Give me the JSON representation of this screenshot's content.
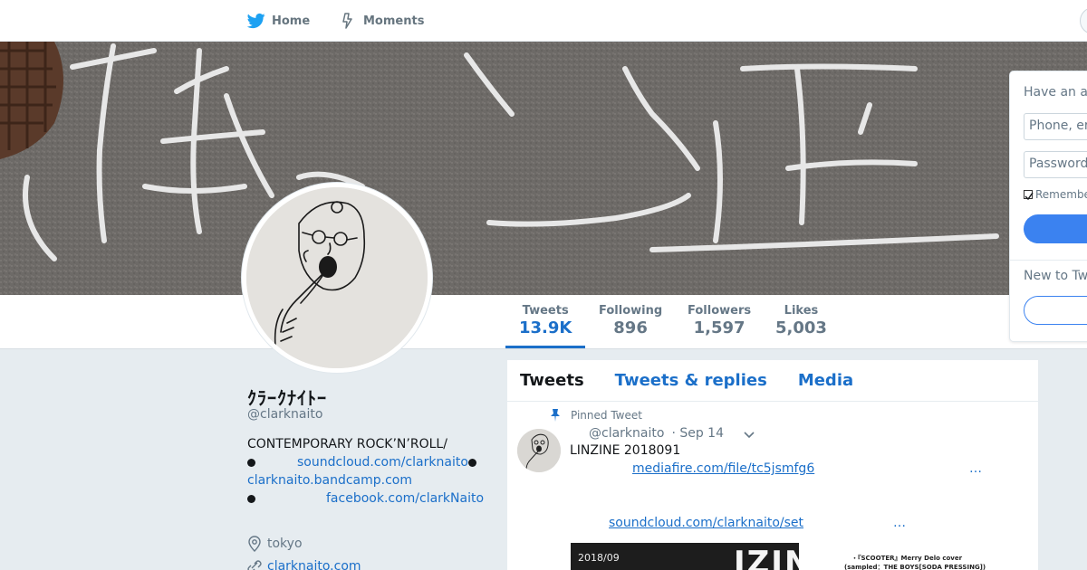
{
  "nav": {
    "home_label": "Home",
    "moments_label": "Moments"
  },
  "profile": {
    "display_name": "ｸﾗｰｸﾅｲﾄｰ",
    "handle": "@clarknaito",
    "bio_line1": "CONTEMPORARY ROCK’N’ROLL/",
    "bio_link_soundcloud": "soundcloud.com/clarknaito",
    "bio_link_bandcamp": "clarknaito.bandcamp.com",
    "bio_link_facebook": "facebook.com/clarkNaito",
    "location": "tokyo",
    "website": "clarknaito.com"
  },
  "stats": [
    {
      "label": "Tweets",
      "value": "13.9K"
    },
    {
      "label": "Following",
      "value": "896"
    },
    {
      "label": "Followers",
      "value": "1,597"
    },
    {
      "label": "Likes",
      "value": "5,003"
    }
  ],
  "timeline": {
    "tabs": [
      "Tweets",
      "Tweets & replies",
      "Media"
    ],
    "pinned_label": "Pinned Tweet",
    "tweet": {
      "handle": "@clarknaito",
      "date": "· Sep 14",
      "text": "LINZINE 2018091",
      "link1": "mediafire.com/file/tc5jsmfg6",
      "link1_ellipsis": "…",
      "link2": "soundcloud.com/clarknaito/set",
      "link2_ellipsis": "…",
      "media_left_date": "2018/09",
      "media_left_title": "IZINE",
      "media_right_line1": "・『SCOOTER』Merry Delo cover",
      "media_right_line2": "(sampled：THE BOYS[SODA PRESSING])"
    }
  },
  "login": {
    "heading": "Have an a",
    "phone_placeholder": "Phone, er",
    "password_placeholder": "Password",
    "remember": "Remembe",
    "new_to": "New to Tw"
  },
  "colors": {
    "accent": "#1b6fc9",
    "twitter_blue": "#1da1f2",
    "background": "#e6ecf0"
  }
}
